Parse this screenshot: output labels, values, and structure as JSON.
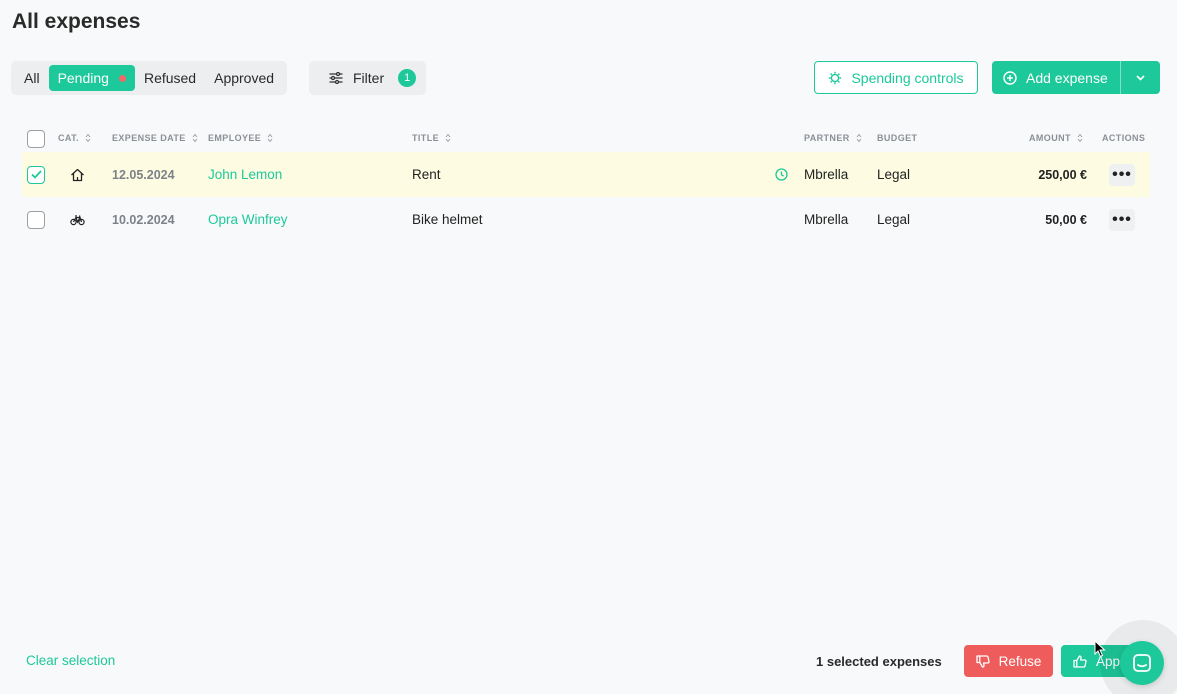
{
  "page": {
    "title": "All expenses"
  },
  "tabs": [
    {
      "label": "All",
      "active": false
    },
    {
      "label": "Pending",
      "active": true
    },
    {
      "label": "Refused",
      "active": false
    },
    {
      "label": "Approved",
      "active": false
    }
  ],
  "filter": {
    "label": "Filter",
    "count": "1"
  },
  "toolbar": {
    "spending_controls_label": "Spending controls",
    "add_expense_label": "Add expense"
  },
  "table": {
    "columns": {
      "category": "CAT.",
      "expense_date": "EXPENSE DATE",
      "employee": "EMPLOYEE",
      "title": "TITLE",
      "partner": "PARTNER",
      "budget": "BUDGET",
      "amount": "AMOUNT",
      "actions": "ACTIONS"
    },
    "rows": [
      {
        "selected": true,
        "category_icon": "house-icon",
        "date": "12.05.2024",
        "employee": "John Lemon",
        "title": "Rent",
        "status_icon": "clock-icon",
        "partner": "Mbrella",
        "budget": "Legal",
        "amount": "250,00 €",
        "actions": "•••"
      },
      {
        "selected": false,
        "category_icon": "bicycle-icon",
        "date": "10.02.2024",
        "employee": "Opra Winfrey",
        "title": "Bike helmet",
        "partner": "Mbrella",
        "budget": "Legal",
        "amount": "50,00 €",
        "actions": "•••"
      }
    ]
  },
  "bottom_bar": {
    "clear_selection_label": "Clear selection",
    "selected_count_text": "1 selected expenses",
    "refuse_label": "Refuse",
    "approve_label": "App"
  },
  "colors": {
    "accent": "#1dc99a",
    "danger": "#ef5c5c",
    "selected_row": "#fdfce3"
  }
}
